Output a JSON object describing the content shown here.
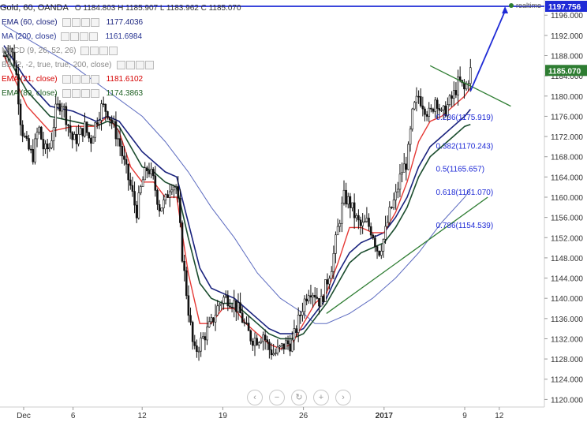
{
  "header": {
    "title": "Gold, 60, OANDA",
    "ohlc": "O 1184.803 H 1185.907 L 1183.962 C 1185.070",
    "realtime_label": "realtime"
  },
  "indicators": [
    {
      "name": "EMA (60, close)",
      "value": "1177.4036",
      "color": "#1a237e"
    },
    {
      "name": "MA (200, close)",
      "value": "1161.6984",
      "color": "#283593"
    },
    {
      "name": "MACD (9, 26, 52, 26)",
      "value": "",
      "color": "#888888"
    },
    {
      "name": "BB (2, -2, true, true, 200, close)",
      "value": "",
      "color": "#888888"
    },
    {
      "name": "EMA (21, close)",
      "value": "1181.6102",
      "color": "#d50000"
    },
    {
      "name": "EMA (89, close)",
      "value": "1174.3863",
      "color": "#1b5e20"
    }
  ],
  "nav_buttons": [
    "‹",
    "−",
    "↻",
    "+",
    "›"
  ],
  "colors": {
    "candles": "#111111",
    "ema21": "#e53935",
    "ema89": "#1b4d2e",
    "ema60": "#1a237e",
    "ma200": "#5c6bc0",
    "trend": "#2e7d32",
    "arrow": "#1f2bd6",
    "price_tag": "#2e7d32",
    "target_tag": "#1f2bd6"
  },
  "chart_data": {
    "type": "candlestick",
    "title": "Gold, 60, OANDA",
    "y_axis": {
      "min": 1120,
      "max": 1200,
      "ticks": [
        "1196.000",
        "1192.000",
        "1188.000",
        "1184.000",
        "1180.000",
        "1176.000",
        "1172.000",
        "1168.000",
        "1164.000",
        "1160.000",
        "1156.000",
        "1152.000",
        "1148.000",
        "1144.000",
        "1140.000",
        "1136.000",
        "1132.000",
        "1128.000",
        "1124.000",
        "1120.000"
      ],
      "tick_values": [
        1196,
        1192,
        1188,
        1184,
        1180,
        1176,
        1172,
        1168,
        1164,
        1160,
        1156,
        1152,
        1148,
        1144,
        1140,
        1136,
        1132,
        1128,
        1124,
        1120
      ]
    },
    "x_axis": {
      "labels": [
        "Dec",
        "6",
        "12",
        "19",
        "26",
        "2017",
        "9",
        "12"
      ],
      "label_days": [
        0,
        6,
        12,
        19,
        26,
        33,
        40,
        43
      ]
    },
    "current_price": "1185.070",
    "target_price": "1197.756",
    "fib_levels": [
      {
        "label": "0.236(1175.919)",
        "value": 1175.919
      },
      {
        "label": "0.382(1170.243)",
        "value": 1170.243
      },
      {
        "label": "0.5(1165.657)",
        "value": 1165.657
      },
      {
        "label": "0.618(1161.070)",
        "value": 1161.07
      },
      {
        "label": "0.786(1154.539)",
        "value": 1154.539
      }
    ],
    "close_path": [
      [
        0,
        1188
      ],
      [
        0.5,
        1190
      ],
      [
        1,
        1186
      ],
      [
        1.5,
        1174
      ],
      [
        2,
        1170
      ],
      [
        2.5,
        1168
      ],
      [
        3,
        1174
      ],
      [
        3.5,
        1169
      ],
      [
        4,
        1170
      ],
      [
        4.5,
        1177
      ],
      [
        5,
        1179
      ],
      [
        5.5,
        1175
      ],
      [
        6,
        1171
      ],
      [
        6.5,
        1172
      ],
      [
        7,
        1174
      ],
      [
        7.5,
        1171
      ],
      [
        8,
        1175
      ],
      [
        8.5,
        1178
      ],
      [
        9,
        1177
      ],
      [
        9.5,
        1174
      ],
      [
        10,
        1171
      ],
      [
        10.5,
        1166
      ],
      [
        11,
        1162
      ],
      [
        11.5,
        1157
      ],
      [
        12,
        1163
      ],
      [
        12.5,
        1166
      ],
      [
        13,
        1163
      ],
      [
        13.5,
        1158
      ],
      [
        14,
        1159
      ],
      [
        14.5,
        1163
      ],
      [
        15,
        1162
      ],
      [
        15.5,
        1148
      ],
      [
        16,
        1138
      ],
      [
        16.5,
        1129
      ],
      [
        17,
        1131
      ],
      [
        17.5,
        1133
      ],
      [
        18,
        1135
      ],
      [
        18.5,
        1138
      ],
      [
        19,
        1140
      ],
      [
        19.5,
        1140
      ],
      [
        20,
        1139
      ],
      [
        20.5,
        1137
      ],
      [
        21,
        1134
      ],
      [
        21.5,
        1132
      ],
      [
        22,
        1132
      ],
      [
        22.5,
        1133
      ],
      [
        23,
        1130
      ],
      [
        23.5,
        1129
      ],
      [
        24,
        1130
      ],
      [
        24.5,
        1131
      ],
      [
        25,
        1131
      ],
      [
        25.5,
        1135
      ],
      [
        26,
        1139
      ],
      [
        26.5,
        1142
      ],
      [
        27,
        1141
      ],
      [
        27.5,
        1139
      ],
      [
        28,
        1143
      ],
      [
        28.5,
        1147
      ],
      [
        29,
        1154
      ],
      [
        29.5,
        1160
      ],
      [
        30,
        1159
      ],
      [
        30.5,
        1156
      ],
      [
        31,
        1154
      ],
      [
        31.5,
        1155
      ],
      [
        32,
        1153
      ],
      [
        32.5,
        1149
      ],
      [
        33,
        1152
      ],
      [
        33.5,
        1157
      ],
      [
        34,
        1160
      ],
      [
        34.5,
        1165
      ],
      [
        35,
        1167
      ],
      [
        35.5,
        1177
      ],
      [
        36,
        1180
      ],
      [
        36.5,
        1178
      ],
      [
        37,
        1176
      ],
      [
        37.5,
        1180
      ],
      [
        38,
        1176
      ],
      [
        38.5,
        1178
      ],
      [
        39,
        1180
      ],
      [
        39.5,
        1183
      ],
      [
        40,
        1181
      ],
      [
        40.5,
        1185
      ]
    ],
    "ema21_path": [
      [
        0,
        1188
      ],
      [
        2,
        1178
      ],
      [
        4,
        1173
      ],
      [
        6,
        1174
      ],
      [
        8,
        1174
      ],
      [
        9,
        1176
      ],
      [
        10,
        1173
      ],
      [
        11,
        1166
      ],
      [
        12,
        1163
      ],
      [
        13,
        1163
      ],
      [
        14,
        1160
      ],
      [
        15,
        1160
      ],
      [
        16,
        1145
      ],
      [
        17,
        1135
      ],
      [
        18,
        1135
      ],
      [
        19,
        1138
      ],
      [
        20,
        1138
      ],
      [
        21,
        1135
      ],
      [
        22,
        1133
      ],
      [
        23,
        1131
      ],
      [
        24,
        1130
      ],
      [
        25,
        1131
      ],
      [
        26,
        1135
      ],
      [
        27,
        1139
      ],
      [
        28,
        1141
      ],
      [
        29,
        1147
      ],
      [
        30,
        1154
      ],
      [
        31,
        1154
      ],
      [
        32,
        1153
      ],
      [
        33,
        1153
      ],
      [
        34,
        1157
      ],
      [
        35,
        1163
      ],
      [
        36,
        1171
      ],
      [
        37,
        1175
      ],
      [
        38,
        1176
      ],
      [
        39,
        1178
      ],
      [
        40,
        1180
      ],
      [
        40.5,
        1181.6
      ]
    ],
    "ema89_path": [
      [
        0,
        1189
      ],
      [
        2,
        1181
      ],
      [
        4,
        1176
      ],
      [
        6,
        1175
      ],
      [
        8,
        1174
      ],
      [
        9,
        1175
      ],
      [
        10,
        1174
      ],
      [
        11,
        1170
      ],
      [
        12,
        1166
      ],
      [
        13,
        1165
      ],
      [
        14,
        1163
      ],
      [
        15,
        1162
      ],
      [
        16,
        1152
      ],
      [
        17,
        1143
      ],
      [
        18,
        1140
      ],
      [
        19,
        1139
      ],
      [
        20,
        1139
      ],
      [
        21,
        1137
      ],
      [
        22,
        1135
      ],
      [
        23,
        1133
      ],
      [
        24,
        1132
      ],
      [
        25,
        1132
      ],
      [
        26,
        1133
      ],
      [
        27,
        1136
      ],
      [
        28,
        1139
      ],
      [
        29,
        1143
      ],
      [
        30,
        1147
      ],
      [
        31,
        1149
      ],
      [
        32,
        1150
      ],
      [
        33,
        1151
      ],
      [
        34,
        1154
      ],
      [
        35,
        1158
      ],
      [
        36,
        1164
      ],
      [
        37,
        1168
      ],
      [
        38,
        1170
      ],
      [
        39,
        1172
      ],
      [
        40,
        1174
      ],
      [
        40.5,
        1174.4
      ]
    ],
    "ema60_path": [
      [
        0,
        1190
      ],
      [
        2,
        1183
      ],
      [
        4,
        1178
      ],
      [
        6,
        1177
      ],
      [
        8,
        1175
      ],
      [
        9,
        1176
      ],
      [
        10,
        1175
      ],
      [
        11,
        1172
      ],
      [
        12,
        1169
      ],
      [
        13,
        1167
      ],
      [
        14,
        1165
      ],
      [
        15,
        1164
      ],
      [
        16,
        1155
      ],
      [
        17,
        1146
      ],
      [
        18,
        1142
      ],
      [
        19,
        1141
      ],
      [
        20,
        1140
      ],
      [
        21,
        1138
      ],
      [
        22,
        1136
      ],
      [
        23,
        1134
      ],
      [
        24,
        1133
      ],
      [
        25,
        1133
      ],
      [
        26,
        1134
      ],
      [
        27,
        1137
      ],
      [
        28,
        1140
      ],
      [
        29,
        1145
      ],
      [
        30,
        1149
      ],
      [
        31,
        1151
      ],
      [
        32,
        1152
      ],
      [
        33,
        1153
      ],
      [
        34,
        1156
      ],
      [
        35,
        1160
      ],
      [
        36,
        1166
      ],
      [
        37,
        1170
      ],
      [
        38,
        1172
      ],
      [
        39,
        1174
      ],
      [
        40,
        1176
      ],
      [
        40.5,
        1177.4
      ]
    ],
    "ma200_path": [
      [
        0,
        1194
      ],
      [
        3,
        1190
      ],
      [
        6,
        1186
      ],
      [
        9,
        1181
      ],
      [
        12,
        1176
      ],
      [
        14,
        1171
      ],
      [
        16,
        1165
      ],
      [
        18,
        1158
      ],
      [
        20,
        1152
      ],
      [
        22,
        1145
      ],
      [
        24,
        1140
      ],
      [
        26,
        1137
      ],
      [
        27,
        1135
      ],
      [
        28,
        1135
      ],
      [
        30,
        1137
      ],
      [
        32,
        1140
      ],
      [
        34,
        1144
      ],
      [
        36,
        1149
      ],
      [
        38,
        1155
      ],
      [
        40,
        1160
      ],
      [
        40.5,
        1161.7
      ]
    ],
    "upper_trendline": [
      [
        37,
        1186
      ],
      [
        44,
        1178
      ]
    ],
    "lower_trendline": [
      [
        28,
        1137
      ],
      [
        42,
        1160
      ]
    ],
    "projection_arrow": [
      [
        40.5,
        1181
      ],
      [
        43.5,
        1197.756
      ]
    ]
  }
}
